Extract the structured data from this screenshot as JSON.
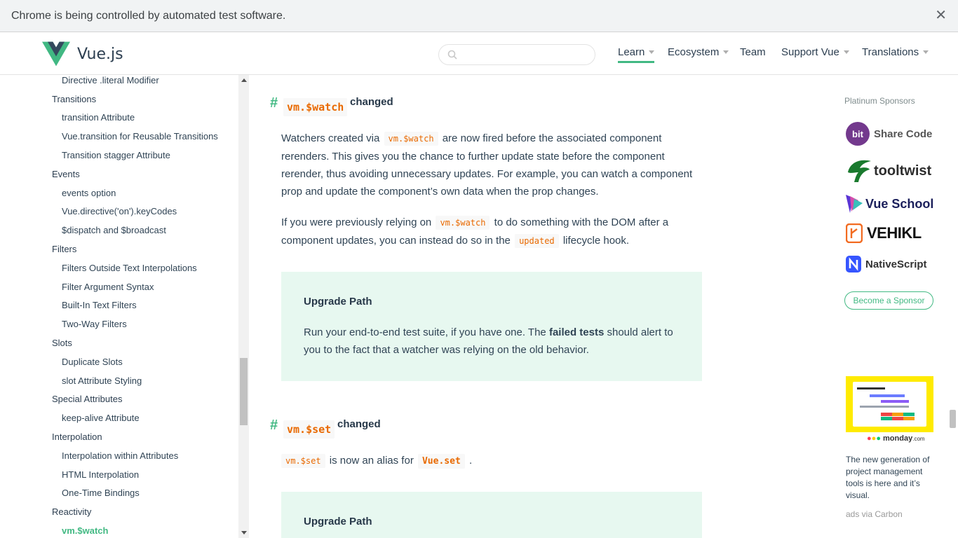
{
  "infobar": {
    "message": "Chrome is being controlled by automated test software.",
    "close_glyph": "✕"
  },
  "header": {
    "logo_text": "Vue.js",
    "search_placeholder": "",
    "nav": [
      {
        "label": "Learn",
        "active": true,
        "dropdown": true
      },
      {
        "label": "Ecosystem",
        "dropdown": true
      },
      {
        "label": "Team",
        "dropdown": false
      },
      {
        "label": "Support Vue",
        "dropdown": true
      },
      {
        "label": "Translations",
        "dropdown": true
      }
    ]
  },
  "sidebar": {
    "items": [
      {
        "label": "Directive .literal Modifier",
        "level": "sub"
      },
      {
        "label": "Transitions",
        "level": "section"
      },
      {
        "label": "transition Attribute",
        "level": "sub"
      },
      {
        "label": "Vue.transition for Reusable Transitions",
        "level": "sub"
      },
      {
        "label": "Transition stagger Attribute",
        "level": "sub"
      },
      {
        "label": "Events",
        "level": "section"
      },
      {
        "label": "events option",
        "level": "sub"
      },
      {
        "label": "Vue.directive('on').keyCodes",
        "level": "sub"
      },
      {
        "label": "$dispatch and $broadcast",
        "level": "sub"
      },
      {
        "label": "Filters",
        "level": "section"
      },
      {
        "label": "Filters Outside Text Interpolations",
        "level": "sub"
      },
      {
        "label": "Filter Argument Syntax",
        "level": "sub"
      },
      {
        "label": "Built-In Text Filters",
        "level": "sub"
      },
      {
        "label": "Two-Way Filters",
        "level": "sub"
      },
      {
        "label": "Slots",
        "level": "section"
      },
      {
        "label": "Duplicate Slots",
        "level": "sub"
      },
      {
        "label": "slot Attribute Styling",
        "level": "sub"
      },
      {
        "label": "Special Attributes",
        "level": "section"
      },
      {
        "label": "keep-alive Attribute",
        "level": "sub"
      },
      {
        "label": "Interpolation",
        "level": "section"
      },
      {
        "label": "Interpolation within Attributes",
        "level": "sub"
      },
      {
        "label": "HTML Interpolation",
        "level": "sub"
      },
      {
        "label": "One-Time Bindings",
        "level": "sub"
      },
      {
        "label": "Reactivity",
        "level": "section"
      },
      {
        "label": "vm.$watch",
        "level": "sub",
        "active": true
      }
    ]
  },
  "main": {
    "section1": {
      "hash": "#",
      "code": "vm.$watch",
      "heading": "changed",
      "p1": {
        "a": "Watchers created via",
        "code": "vm.$watch",
        "b": "are now fired before the associated component rerenders. This gives you the chance to further update state before the component rerender, thus avoiding unnecessary updates. For example, you can watch a component prop and update the component’s own data when the prop changes."
      },
      "p2": {
        "a": "If you were previously relying on",
        "code": "vm.$watch",
        "b": "to do something with the DOM after a component updates, you can instead do so in the",
        "code2": "updated",
        "c": "lifecycle hook."
      },
      "tip": {
        "title": "Upgrade Path",
        "a": "Run your end-to-end test suite, if you have one. The",
        "bold": "failed tests",
        "b": "should alert to you to the fact that a watcher was relying on the old behavior."
      }
    },
    "section2": {
      "hash": "#",
      "code": "vm.$set",
      "heading": "changed",
      "p1": {
        "code": "vm.$set",
        "a": "is now an alias for",
        "code2": "Vue.set",
        "b": "."
      },
      "tip": {
        "title": "Upgrade Path"
      }
    }
  },
  "sponsors": {
    "title": "Platinum Sponsors",
    "items": [
      {
        "name": "Share Code",
        "badge": "bit",
        "color": "#73398d"
      },
      {
        "name": "tooltwist",
        "color": "#2d2d2d",
        "accent": "#1a7a2e"
      },
      {
        "name": "Vue School",
        "color": "#1b1f5b"
      },
      {
        "name": "VEHIKL",
        "color": "#111111",
        "accent": "#f26b21"
      },
      {
        "name": "NativeScript",
        "color": "#333333",
        "accent": "#3655ff"
      }
    ],
    "button": "Become a Sponsor"
  },
  "ad": {
    "brand": "monday",
    "brand_suffix": ".com",
    "text": "The new generation of project management tools is here and it’s visual.",
    "via": "ads via Carbon"
  },
  "colors": {
    "accent": "#42b983",
    "code": "#e96900",
    "tip_bg": "#e7f8f0"
  }
}
